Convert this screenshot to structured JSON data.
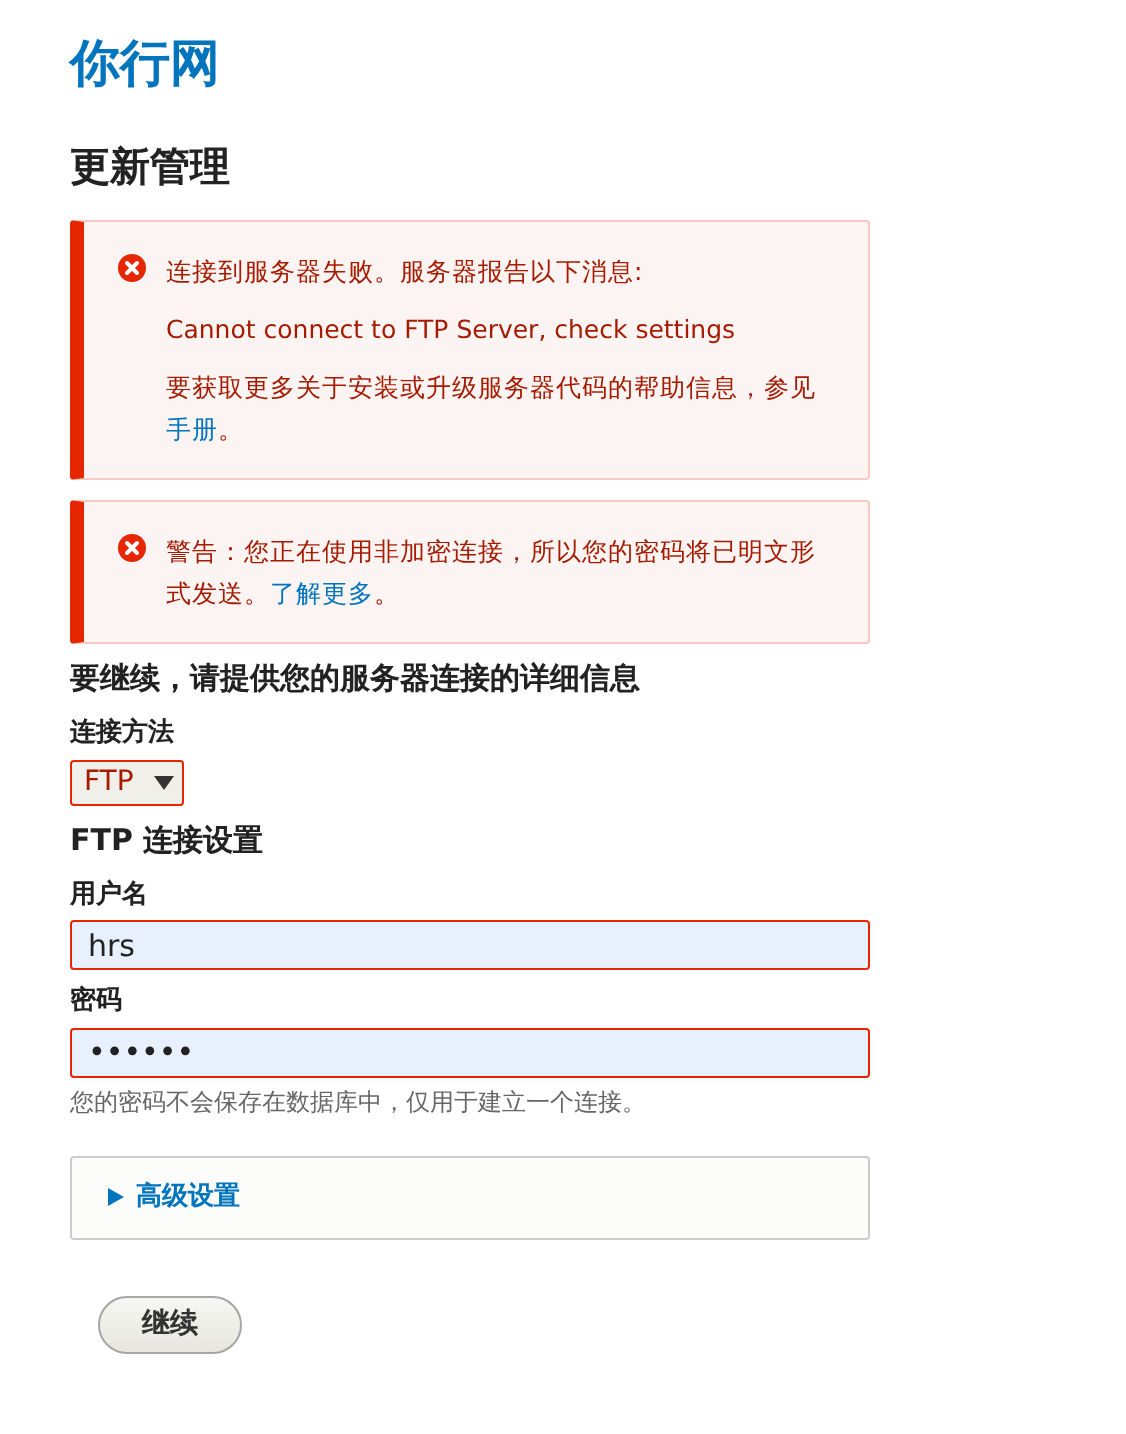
{
  "site_title": "你行网",
  "page_title": "更新管理",
  "messages": [
    {
      "kind": "error",
      "lines": [
        "连接到服务器失败。服务器报告以下消息:",
        "Cannot connect to FTP Server, check settings"
      ],
      "text": "要获取更多关于安装或升级服务器代码的帮助信息，参见",
      "link": "手册",
      "after": "。"
    },
    {
      "kind": "error",
      "text": "警告：您正在使用非加密连接，所以您的密码将已明文形式发送。",
      "link": "了解更多",
      "after": "。"
    }
  ],
  "section_title": "要继续，请提供您的服务器连接的详细信息",
  "method": {
    "label": "连接方法",
    "value": "FTP",
    "error": true
  },
  "settings_title": "FTP 连接设置",
  "fields": [
    {
      "label": "用户名",
      "value": "hrs",
      "error": true
    },
    {
      "label": "密码",
      "value": "••••••",
      "error": true,
      "description": "您的密码不会保存在数据库中，仅用于建立一个连接。"
    }
  ],
  "advanced": {
    "label": "高级设置",
    "expanded": false
  },
  "submit": "继续"
}
